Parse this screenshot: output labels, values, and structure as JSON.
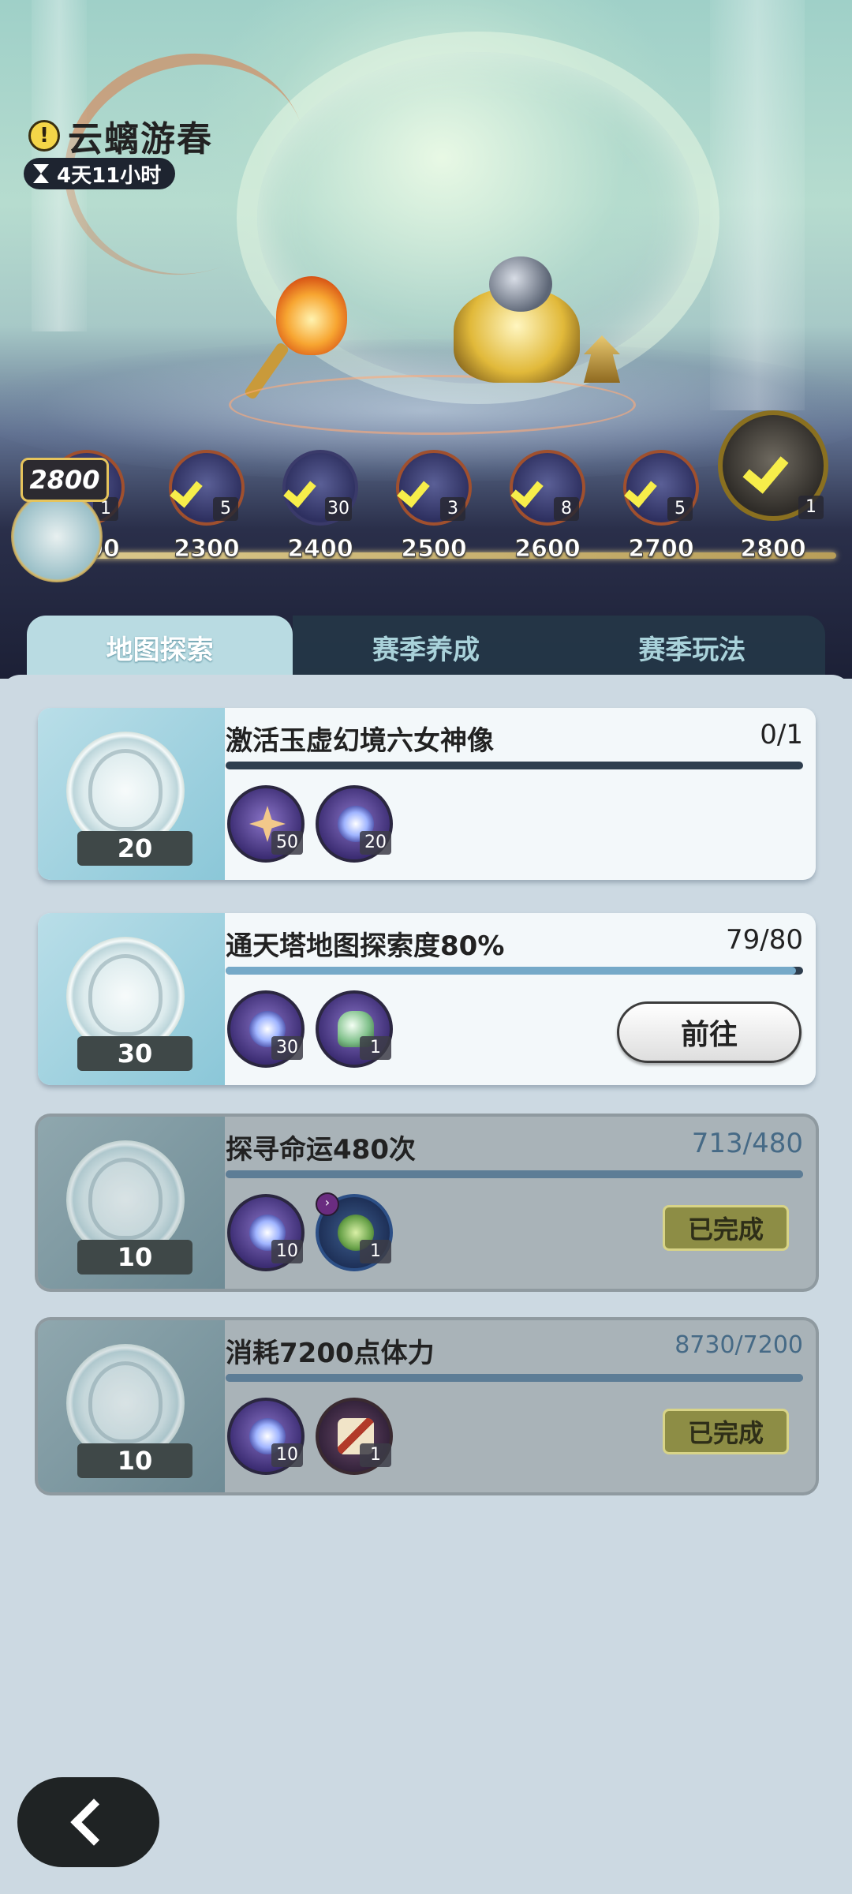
{
  "event": {
    "title": "云螭游春",
    "timer": "4天11小时",
    "current_points": "2800"
  },
  "milestones": [
    {
      "label": "2200",
      "qty": "1",
      "icon": "gem-box-icon"
    },
    {
      "label": "2300",
      "qty": "5",
      "icon": "gem-box-icon"
    },
    {
      "label": "2400",
      "qty": "30",
      "icon": "book-icon"
    },
    {
      "label": "2500",
      "qty": "3",
      "icon": "gem-box-icon"
    },
    {
      "label": "2600",
      "qty": "8",
      "icon": "gem-box-icon"
    },
    {
      "label": "2700",
      "qty": "5",
      "icon": "gem-box-icon"
    },
    {
      "label": "2800",
      "qty": "1",
      "icon": "treasure-chest-icon"
    }
  ],
  "tabs": [
    {
      "label": "地图探索",
      "active": true
    },
    {
      "label": "赛季养成",
      "active": false
    },
    {
      "label": "赛季玩法",
      "active": false
    }
  ],
  "tasks": [
    {
      "points": "20",
      "title": "激活玉虚幻境六女神像",
      "progress": "0/1",
      "progress_fraction": 0.0,
      "status": "incomplete",
      "rewards": [
        {
          "icon": "star-crystal-icon",
          "qty": "50"
        },
        {
          "icon": "star-orb-icon",
          "qty": "20"
        }
      ]
    },
    {
      "points": "30",
      "title": "通天塔地图探索度80%",
      "progress": "79/80",
      "progress_fraction": 0.9875,
      "status": "in_progress",
      "action_label": "前往",
      "rewards": [
        {
          "icon": "star-orb-icon",
          "qty": "30"
        },
        {
          "icon": "flower-bouquet-icon",
          "qty": "1"
        }
      ]
    },
    {
      "points": "10",
      "title": "探寻命运480次",
      "progress": "713/480",
      "progress_fraction": 1.0,
      "status": "done",
      "status_label": "已完成",
      "rewards": [
        {
          "icon": "star-orb-icon",
          "qty": "10"
        },
        {
          "icon": "jade-dish-icon",
          "qty": "1"
        }
      ]
    },
    {
      "points": "10",
      "title": "消耗7200点体力",
      "progress": "8730/7200",
      "progress_fraction": 1.0,
      "status": "done",
      "status_label": "已完成",
      "rewards": [
        {
          "icon": "star-orb-icon",
          "qty": "10"
        },
        {
          "icon": "scroll-icon",
          "qty": "1"
        }
      ]
    }
  ],
  "back_icon": "chevron-left-icon"
}
